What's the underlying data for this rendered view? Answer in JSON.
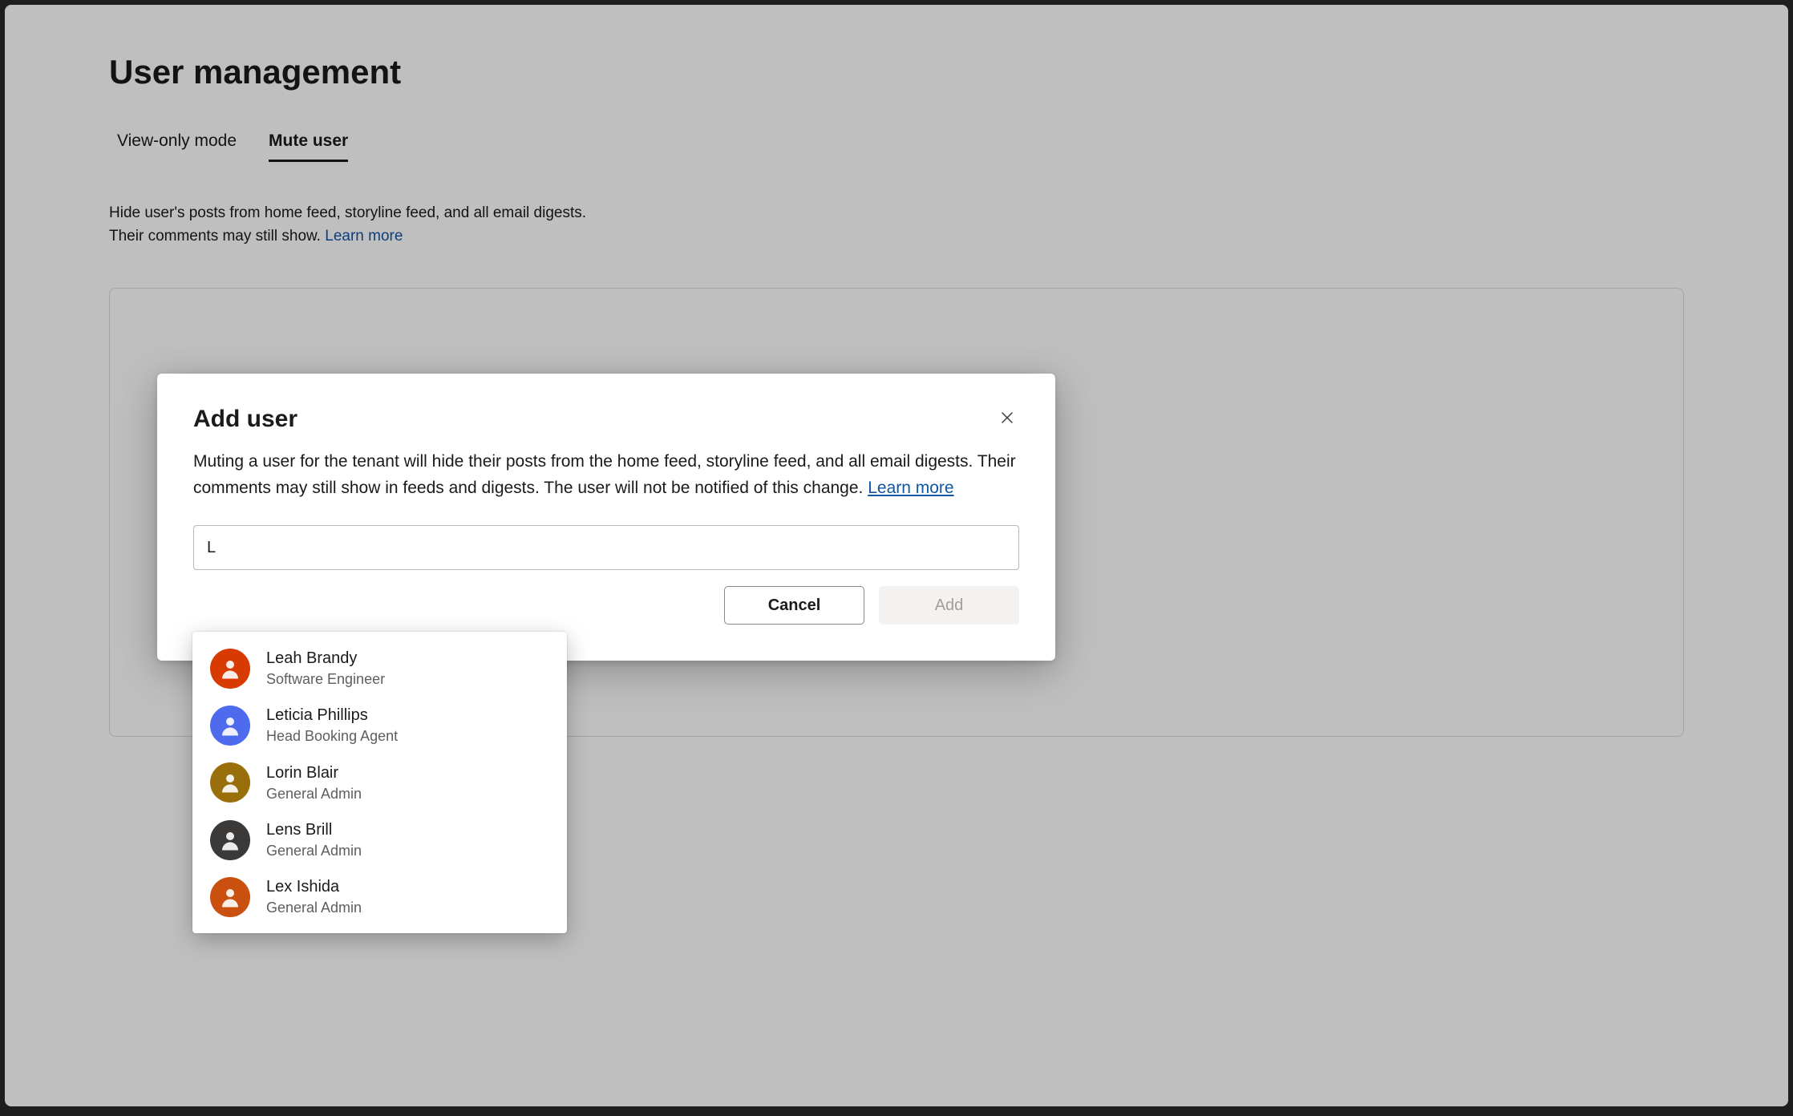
{
  "page": {
    "title": "User management",
    "tabs": [
      {
        "label": "View-only mode",
        "active": false
      },
      {
        "label": "Mute user",
        "active": true
      }
    ],
    "description_line1": "Hide user's posts from home feed, storyline feed, and all email digests.",
    "description_line2_prefix": "Their comments may still show. ",
    "learn_more": "Learn more"
  },
  "modal": {
    "title": "Add user",
    "description": "Muting a user for the tenant will hide their posts from the home feed, storyline feed, and all email digests. Their comments may still show in feeds and digests. The user will not be notified of this change. ",
    "learn_more": "Learn more",
    "search_value": "L",
    "cancel_label": "Cancel",
    "add_label": "Add"
  },
  "suggestions": [
    {
      "name": "Leah Brandy",
      "role": "Software Engineer",
      "avatar_bg": "#d83b01"
    },
    {
      "name": "Leticia Phillips",
      "role": "Head Booking Agent",
      "avatar_bg": "#4f6bed"
    },
    {
      "name": "Lorin Blair",
      "role": "General Admin",
      "avatar_bg": "#986f0b"
    },
    {
      "name": "Lens Brill",
      "role": "General Admin",
      "avatar_bg": "#3b3a39"
    },
    {
      "name": "Lex Ishida",
      "role": "General Admin",
      "avatar_bg": "#ca5010"
    }
  ]
}
